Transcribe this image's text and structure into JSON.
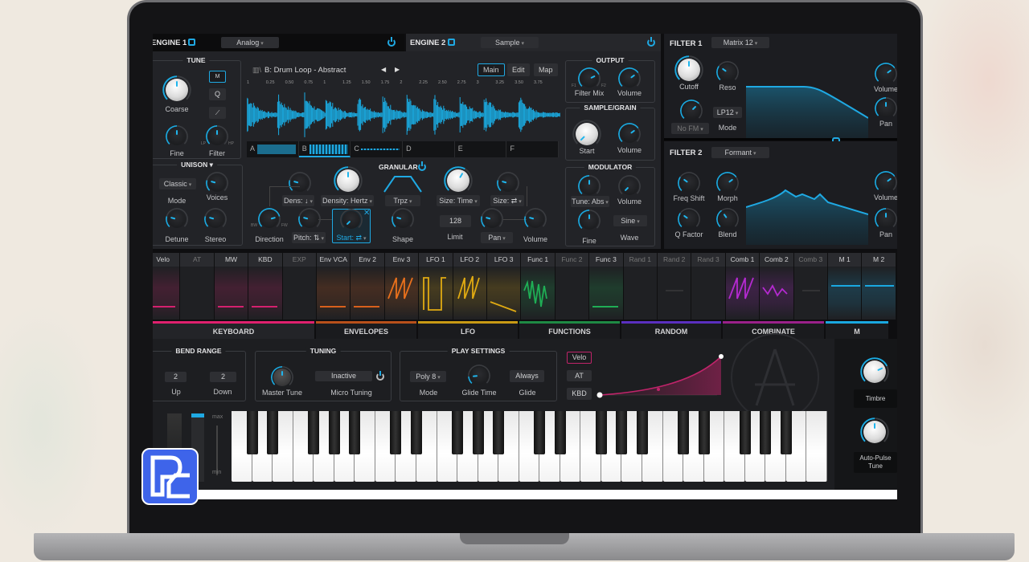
{
  "engine1": {
    "title": "ENGINE 1",
    "type": "Analog"
  },
  "engine2": {
    "title": "ENGINE 2",
    "type": "Sample"
  },
  "tune": {
    "title": "TUNE",
    "coarse": "Coarse",
    "fine": "Fine",
    "filter": "Filter",
    "lp": "LP",
    "hp": "HP",
    "buttons": [
      "M",
      "Q",
      "⟋"
    ]
  },
  "unison": {
    "title": "UNISON ▾",
    "mode_value": "Classic",
    "mode": "Mode",
    "voices": "Voices",
    "detune": "Detune",
    "stereo": "Stereo"
  },
  "sample": {
    "name": "B: Drum Loop - Abstract",
    "tabs": [
      "Main",
      "Edit",
      "Map"
    ],
    "ruler": [
      "1",
      "0.25",
      "0.50",
      "0.75",
      "1",
      "1.25",
      "1.50",
      "1.75",
      "2",
      "2.25",
      "2.50",
      "2.75",
      "3",
      "3.25",
      "3.50",
      "3.75"
    ],
    "slots": [
      "A",
      "B",
      "C",
      "D",
      "E",
      "F"
    ]
  },
  "granular": {
    "title": "GRANULAR",
    "dens": "Dens: ↓",
    "density": "Density: Hertz",
    "shape_type": "Trpz",
    "size_time": "Size: Time",
    "size": "Size: ⇄",
    "direction": "Direction",
    "bw": "BW",
    "fw": "FW",
    "pitch": "Pitch: ⇅",
    "start": "Start: ⇄",
    "shape": "Shape",
    "limit_value": "128",
    "limit": "Limit",
    "pan": "Pan",
    "volume": "Volume"
  },
  "output": {
    "title": "OUTPUT",
    "filter_mix": "Filter Mix",
    "volume": "Volume",
    "f1": "F1",
    "f2": "F2"
  },
  "sample_grain": {
    "title": "SAMPLE/GRAIN",
    "start": "Start",
    "volume": "Volume"
  },
  "modulator": {
    "title": "MODULATOR",
    "tune": "Tune: Abs",
    "volume": "Volume",
    "fine": "Fine",
    "wave_value": "Sine",
    "wave": "Wave"
  },
  "filter1": {
    "title": "FILTER 1",
    "type": "Matrix 12",
    "cutoff": "Cutoff",
    "reso": "Reso",
    "fm": "No FM",
    "mode_value": "LP12",
    "mode": "Mode",
    "volume": "Volume",
    "pan": "Pan"
  },
  "filter2": {
    "title": "FILTER 2",
    "type": "Formant",
    "freq_shift": "Freq Shift",
    "morph": "Morph",
    "q": "Q Factor",
    "blend": "Blend",
    "volume": "Volume",
    "pan": "Pan"
  },
  "mod_sources": [
    {
      "label": "Velo",
      "color": "#d4206e",
      "active": true,
      "wave": "bar"
    },
    {
      "label": "AT",
      "color": "#555",
      "active": false,
      "wave": "none"
    },
    {
      "label": "MW",
      "color": "#d4206e",
      "active": true,
      "wave": "bar"
    },
    {
      "label": "KBD",
      "color": "#d4206e",
      "active": true,
      "wave": "bar"
    },
    {
      "label": "EXP",
      "color": "#555",
      "active": false,
      "wave": "none"
    },
    {
      "label": "Env VCA",
      "color": "#d8601c",
      "active": true,
      "wave": "bar"
    },
    {
      "label": "Env 2",
      "color": "#d8601c",
      "active": true,
      "wave": "bar"
    },
    {
      "label": "Env 3",
      "color": "#e8701c",
      "active": true,
      "wave": "zigzag"
    },
    {
      "label": "LFO 1",
      "color": "#e0aa12",
      "active": true,
      "wave": "square"
    },
    {
      "label": "LFO 2",
      "color": "#e0aa12",
      "active": true,
      "wave": "saw"
    },
    {
      "label": "LFO 3",
      "color": "#e0aa12",
      "active": true,
      "wave": "ramp"
    },
    {
      "label": "Func 1",
      "color": "#1fae55",
      "active": true,
      "wave": "noise"
    },
    {
      "label": "Func 2",
      "color": "#555",
      "active": false,
      "wave": "none"
    },
    {
      "label": "Func 3",
      "color": "#1fae55",
      "active": true,
      "wave": "bar"
    },
    {
      "label": "Rand 1",
      "color": "#555",
      "active": false,
      "wave": "none"
    },
    {
      "label": "Rand 2",
      "color": "#555",
      "active": false,
      "wave": "flat"
    },
    {
      "label": "Rand 3",
      "color": "#555",
      "active": false,
      "wave": "none"
    },
    {
      "label": "Comb 1",
      "color": "#b42ad0",
      "active": true,
      "wave": "zigzag"
    },
    {
      "label": "Comb 2",
      "color": "#b42ad0",
      "active": true,
      "wave": "zigzag2"
    },
    {
      "label": "Comb 3",
      "color": "#555",
      "active": false,
      "wave": "flat"
    },
    {
      "label": "M 1",
      "color": "#1aa8e0",
      "active": true,
      "wave": "line"
    },
    {
      "label": "M 2",
      "color": "#1aa8e0",
      "active": true,
      "wave": "line"
    }
  ],
  "mod_tabs": [
    {
      "label": "KEYBOARD",
      "color": "#e0206e"
    },
    {
      "label": "ENVELOPES",
      "color": "#b8501a"
    },
    {
      "label": "LFO",
      "color": "#c89a14"
    },
    {
      "label": "FUNCTIONS",
      "color": "#1e8a44"
    },
    {
      "label": "RANDOM",
      "color": "#5a2fc0"
    },
    {
      "label": "COMBINATE",
      "color": "#9a208a"
    },
    {
      "label": "M",
      "color": "#1aa8e0"
    }
  ],
  "keyboard_panel": {
    "bend": {
      "title": "BEND RANGE",
      "up_value": "2",
      "up": "Up",
      "down_value": "2",
      "down": "Down"
    },
    "tuning": {
      "title": "TUNING",
      "master": "Master Tune",
      "micro_value": "Inactive",
      "micro": "Micro Tuning"
    },
    "play": {
      "title": "PLAY SETTINGS",
      "mode_value": "Poly 8",
      "mode": "Mode",
      "glide_time": "Glide Time",
      "glide_value": "Always",
      "glide": "Glide"
    },
    "curve_buttons": [
      "Velo",
      "AT",
      "KBD"
    ],
    "max": "max",
    "min": "min",
    "timbre": "Timbre",
    "auto_pulse": "Auto-Pulse Tune"
  },
  "logo": "PC"
}
